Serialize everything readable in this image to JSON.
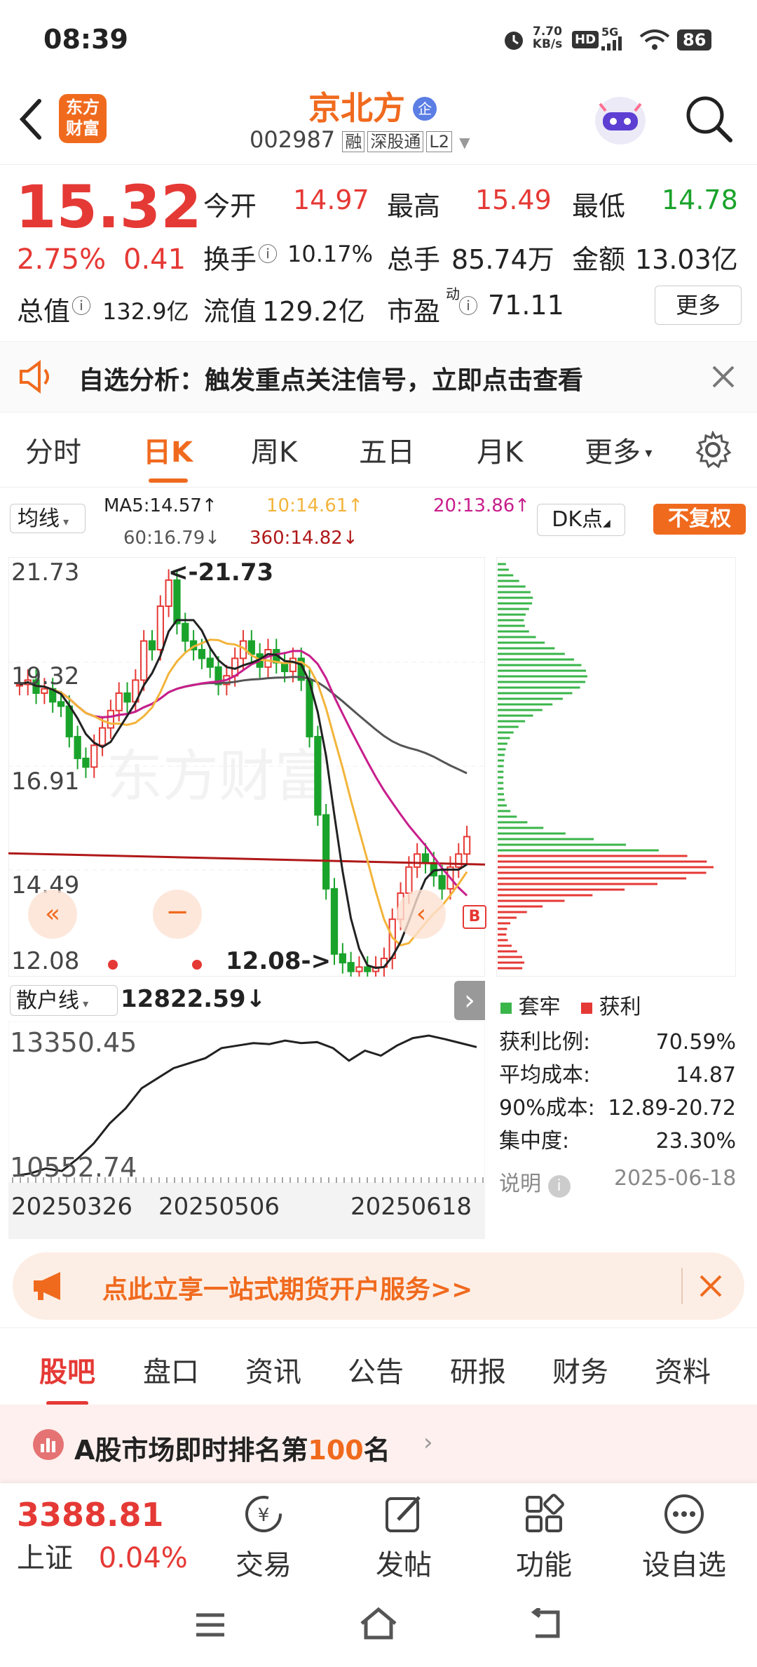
{
  "status_bar": {
    "time": "08:39",
    "speed": "7.70",
    "speed_unit": "KB/s",
    "hd": "HD",
    "net": "5G",
    "battery": "86"
  },
  "header": {
    "back_icon": "chevron-left-icon",
    "logo_line1": "东方",
    "logo_line2": "财富",
    "stock_name": "京北方",
    "company_badge": "企",
    "stock_code": "002987",
    "tag_rong": "融",
    "tag_sgt": "深股通",
    "tag_l2": "L2"
  },
  "quote": {
    "price": "15.32",
    "change_pct": "2.75%",
    "change_amt": "0.41",
    "open_label": "今开",
    "open": "14.97",
    "high_label": "最高",
    "high": "15.49",
    "low_label": "最低",
    "low": "14.78",
    "turnover_label": "换手",
    "turnover": "10.17%",
    "volume_label": "总手",
    "volume": "85.74万",
    "amount_label": "金额",
    "amount": "13.03亿",
    "mktcap_label": "总值",
    "mktcap": "132.9亿",
    "float_label": "流值",
    "float": "129.2亿",
    "pe_label": "市盈",
    "pe_sup": "动",
    "pe": "71.11",
    "more": "更多"
  },
  "banner": {
    "text": "自选分析：触发重点关注信号，立即点击查看"
  },
  "ktabs": {
    "items": [
      "分时",
      "日K",
      "周K",
      "五日",
      "月K",
      "更多"
    ],
    "active": 1
  },
  "ma_bar": {
    "ma_select": "均线",
    "ma5": "MA5:14.57",
    "ma10": "10:14.61",
    "ma20": "20:13.86",
    "ma60": "60:16.79",
    "ma360": "360:14.82",
    "dk": "DK点",
    "fq": "不复权"
  },
  "kchart": {
    "y_labels": [
      "21.73",
      "19.32",
      "16.91",
      "14.49",
      "12.08"
    ],
    "max_marker": "<-21.73",
    "min_marker": "12.08->",
    "watermark": "东方财富",
    "b_marker": "B"
  },
  "sub_chart": {
    "indicator": "散户线",
    "value": "12822.59",
    "y_top": "13350.45",
    "y_bottom": "10552.74",
    "dates": [
      "20250326",
      "20250506",
      "20250618"
    ]
  },
  "chip": {
    "legend_trapped": "套牢",
    "legend_profit": "获利",
    "rows": [
      {
        "label": "获利比例:",
        "value": "70.59%"
      },
      {
        "label": "平均成本:",
        "value": "14.87"
      },
      {
        "label": "90%成本:",
        "value": "12.89-20.72"
      },
      {
        "label": "集中度:",
        "value": "23.30%"
      }
    ],
    "note_label": "说明",
    "date": "2025-06-18"
  },
  "chart_data": {
    "type": "candlestick",
    "ylim": [
      12.08,
      21.73
    ],
    "y_ticks": [
      21.73,
      19.32,
      16.91,
      14.49,
      12.08
    ],
    "x_ticks": [
      "20250326",
      "20250506",
      "20250618"
    ],
    "max": 21.73,
    "min": 12.08,
    "ma": {
      "MA5": 14.57,
      "MA10": 14.61,
      "MA20": 13.86,
      "MA60": 16.79,
      "MA360": 14.82
    },
    "colors": {
      "up": "#e53935",
      "down": "#1aa32b",
      "ma5": "#222222",
      "ma10": "#f3b43b",
      "ma20": "#c81e8c",
      "ma60": "#555555",
      "ma360": "#b01818"
    }
  },
  "promo": {
    "text": "点此立享一站式期货开户服务>>"
  },
  "btabs": {
    "items": [
      "股吧",
      "盘口",
      "资讯",
      "公告",
      "研报",
      "财务",
      "资料"
    ],
    "active": 0
  },
  "rank": {
    "prefix": "A股市场即时排名第",
    "num": "100",
    "suffix": "名"
  },
  "bottom_nav": {
    "index_value": "3388.81",
    "index_name": "上证",
    "index_change": "0.04%",
    "items": [
      "交易",
      "发帖",
      "功能",
      "设自选"
    ]
  },
  "colors": {
    "accent": "#f06a1e",
    "up": "#e53935",
    "down": "#1aa32b"
  }
}
